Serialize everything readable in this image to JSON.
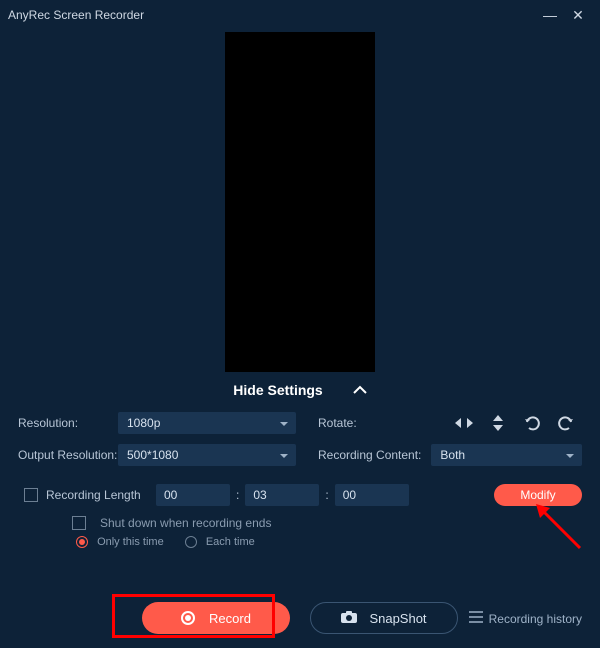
{
  "titlebar": {
    "title": "AnyRec Screen Recorder"
  },
  "hide_settings": {
    "label": "Hide Settings"
  },
  "settings": {
    "resolution_label": "Resolution:",
    "resolution_value": "1080p",
    "rotate_label": "Rotate:",
    "output_res_label": "Output Resolution:",
    "output_res_value": "500*1080",
    "recording_content_label": "Recording Content:",
    "recording_content_value": "Both",
    "recording_length_label": "Recording Length",
    "hh": "00",
    "mm": "03",
    "ss": "00",
    "modify_label": "Modify",
    "shutdown_label": "Shut down when recording ends",
    "only_this_time": "Only this time",
    "each_time": "Each time"
  },
  "bottom": {
    "record_label": "Record",
    "snapshot_label": "SnapShot",
    "history_label": "Recording history"
  }
}
